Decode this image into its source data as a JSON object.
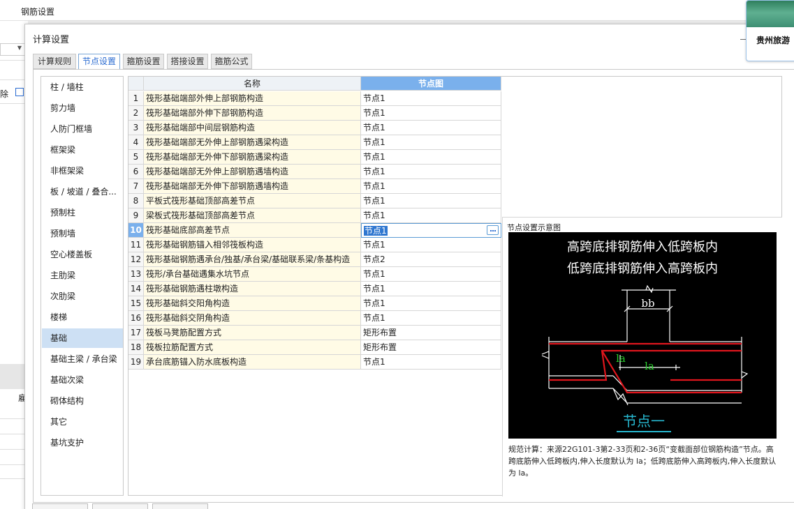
{
  "app": {
    "title": "钢筋设置"
  },
  "background": {
    "del_label": "除",
    "side_label": "雇"
  },
  "popup": {
    "text": "贵州旅游"
  },
  "dialog": {
    "title": "计算设置",
    "tabs": [
      {
        "label": "计算规则",
        "active": false
      },
      {
        "label": "节点设置",
        "active": true
      },
      {
        "label": "箍筋设置",
        "active": false
      },
      {
        "label": "搭接设置",
        "active": false
      },
      {
        "label": "箍筋公式",
        "active": false
      }
    ]
  },
  "categories": [
    "柱 / 墙柱",
    "剪力墙",
    "人防门框墙",
    "框架梁",
    "非框架梁",
    "板 / 坡道 / 叠合...",
    "预制柱",
    "预制墙",
    "空心楼盖板",
    "主肋梁",
    "次肋梁",
    "楼梯",
    "基础",
    "基础主梁 / 承台梁",
    "基础次梁",
    "砌体结构",
    "其它",
    "基坑支护"
  ],
  "selected_category": "基础",
  "table": {
    "headers": {
      "name": "名称",
      "node": "节点图"
    },
    "selected_row": 10,
    "rows": [
      {
        "idx": "1",
        "name": "筏形基础端部外伸上部钢筋构造",
        "node": "节点1"
      },
      {
        "idx": "2",
        "name": "筏形基础端部外伸下部钢筋构造",
        "node": "节点1"
      },
      {
        "idx": "3",
        "name": "筏形基础端部中间层钢筋构造",
        "node": "节点1"
      },
      {
        "idx": "4",
        "name": "筏形基础端部无外伸上部钢筋遇梁构造",
        "node": "节点1"
      },
      {
        "idx": "5",
        "name": "筏形基础端部无外伸下部钢筋遇梁构造",
        "node": "节点1"
      },
      {
        "idx": "6",
        "name": "筏形基础端部无外伸上部钢筋遇墙构造",
        "node": "节点1"
      },
      {
        "idx": "7",
        "name": "筏形基础端部无外伸下部钢筋遇墙构造",
        "node": "节点1"
      },
      {
        "idx": "8",
        "name": "平板式筏形基础顶部高差节点",
        "node": "节点1"
      },
      {
        "idx": "9",
        "name": "梁板式筏形基础顶部高差节点",
        "node": "节点1"
      },
      {
        "idx": "10",
        "name": "筏形基础底部高差节点",
        "node": "节点1"
      },
      {
        "idx": "11",
        "name": "筏形基础钢筋锚入相邻筏板构造",
        "node": "节点1"
      },
      {
        "idx": "12",
        "name": "筏形基础钢筋遇承台/独基/承台梁/基础联系梁/条基构造",
        "node": "节点2"
      },
      {
        "idx": "13",
        "name": "筏形/承台基础遇集水坑节点",
        "node": "节点1"
      },
      {
        "idx": "14",
        "name": "筏形基础钢筋遇柱墩构造",
        "node": "节点1"
      },
      {
        "idx": "15",
        "name": "筏形基础斜交阳角构造",
        "node": "节点1"
      },
      {
        "idx": "16",
        "name": "筏形基础斜交阴角构造",
        "node": "节点1"
      },
      {
        "idx": "17",
        "name": "筏板马凳筋配置方式",
        "node": "矩形布置"
      },
      {
        "idx": "18",
        "name": "筏板拉筋配置方式",
        "node": "矩形布置"
      },
      {
        "idx": "19",
        "name": "承台底筋锚入防水底板构造",
        "node": "节点1"
      }
    ]
  },
  "diagram": {
    "panel_title": "节点设置示意图",
    "line1": "高跨底排钢筋伸入低跨板内",
    "line2": "低跨底排钢筋伸入高跨板内",
    "dim_bb": "bb",
    "dim_la1": "la",
    "dim_la2": "la",
    "node_label": "节点一",
    "note": "规范计算：来源22G101-3第2-33页和2-36页“变截面部位钢筋构造”节点。高跨底筋伸入低跨板内,伸入长度默认为 la；低跨底筋伸入高跨板内,伸入长度默认为 la。",
    "colors": {
      "rebar": "#e0161d",
      "line": "#ffffff",
      "dim_text": "#29d12c",
      "node_label": "#27b8d0"
    }
  }
}
